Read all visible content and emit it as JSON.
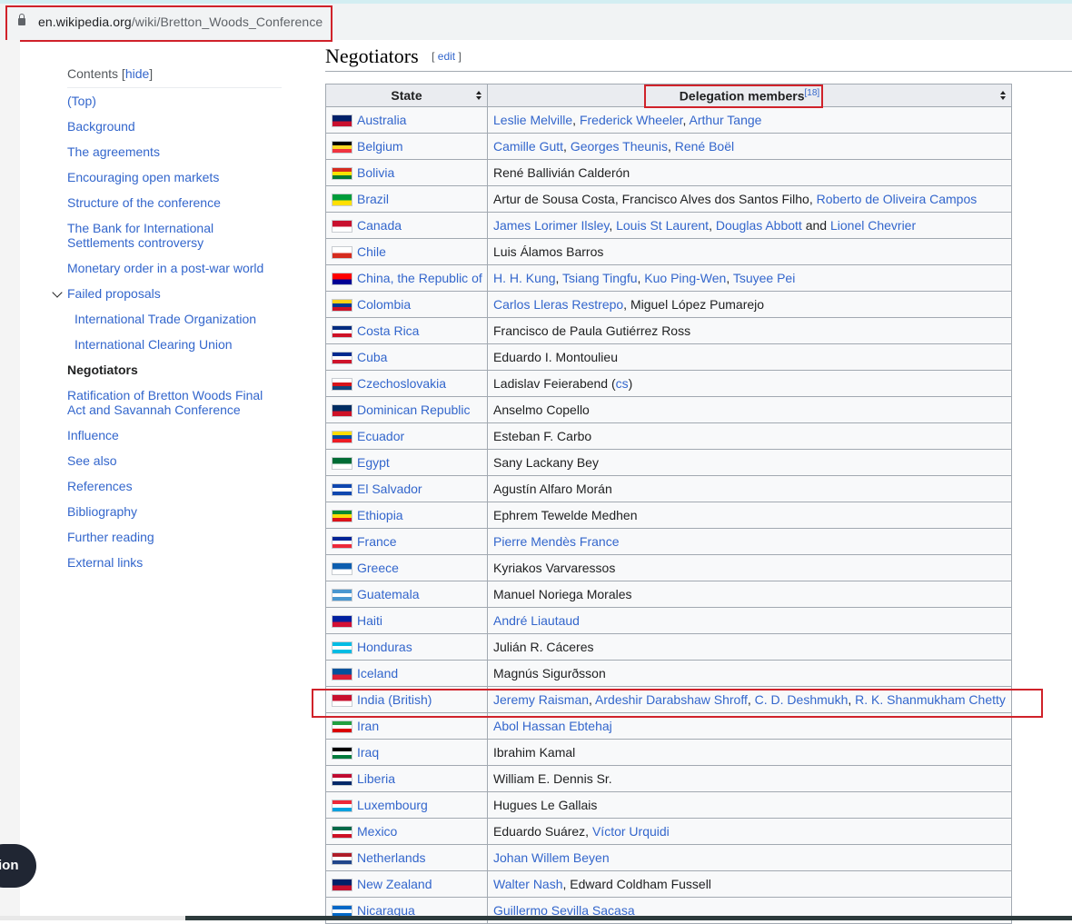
{
  "browser": {
    "url_host": "en.wikipedia.org",
    "url_path": "/wiki/Bretton_Woods_Conference"
  },
  "toc": {
    "title": "Contents",
    "hide_label": "hide",
    "items": [
      {
        "label": "(Top)"
      },
      {
        "label": "Background"
      },
      {
        "label": "The agreements"
      },
      {
        "label": "Encouraging open markets"
      },
      {
        "label": "Structure of the conference"
      },
      {
        "label": "The Bank for International Settlements controversy"
      },
      {
        "label": "Monetary order in a post-war world"
      },
      {
        "label": "Failed proposals"
      },
      {
        "label": "International Trade Organization"
      },
      {
        "label": "International Clearing Union"
      },
      {
        "label": "Negotiators"
      },
      {
        "label": "Ratification of Bretton Woods Final Act and Savannah Conference"
      },
      {
        "label": "Influence"
      },
      {
        "label": "See also"
      },
      {
        "label": "References"
      },
      {
        "label": "Bibliography"
      },
      {
        "label": "Further reading"
      },
      {
        "label": "External links"
      }
    ]
  },
  "section": {
    "title": "Negotiators",
    "edit_label": "edit"
  },
  "table": {
    "col_state": "State",
    "col_members": "Delegation members",
    "ref": "[18]",
    "rows": [
      {
        "state": "Australia",
        "flag": [
          "#012169",
          "#c8102e"
        ],
        "members": [
          {
            "t": "Leslie Melville",
            "l": true
          },
          {
            "t": ", ",
            "l": false
          },
          {
            "t": "Frederick Wheeler",
            "l": true
          },
          {
            "t": ", ",
            "l": false
          },
          {
            "t": "Arthur Tange",
            "l": true
          }
        ]
      },
      {
        "state": "Belgium",
        "flag": [
          "#000000",
          "#fdda24",
          "#ef3340"
        ],
        "members": [
          {
            "t": "Camille Gutt",
            "l": true
          },
          {
            "t": ", ",
            "l": false
          },
          {
            "t": "Georges Theunis",
            "l": true
          },
          {
            "t": ", ",
            "l": false
          },
          {
            "t": "René Boël",
            "l": true
          }
        ]
      },
      {
        "state": "Bolivia",
        "flag": [
          "#d52b1e",
          "#f9e300",
          "#007934"
        ],
        "members": [
          {
            "t": "René Ballivián Calderón",
            "l": false
          }
        ]
      },
      {
        "state": "Brazil",
        "flag": [
          "#009c3b",
          "#ffdf00"
        ],
        "members": [
          {
            "t": "Artur de Sousa Costa, Francisco Alves dos Santos Filho, ",
            "l": false
          },
          {
            "t": "Roberto de Oliveira Campos",
            "l": true
          }
        ]
      },
      {
        "state": "Canada",
        "flag": [
          "#c8102e",
          "#ffffff"
        ],
        "members": [
          {
            "t": "James Lorimer Ilsley",
            "l": true
          },
          {
            "t": ", ",
            "l": false
          },
          {
            "t": "Louis St Laurent",
            "l": true
          },
          {
            "t": ", ",
            "l": false
          },
          {
            "t": "Douglas Abbott",
            "l": true
          },
          {
            "t": " and ",
            "l": false
          },
          {
            "t": "Lionel Chevrier",
            "l": true
          }
        ]
      },
      {
        "state": "Chile",
        "flag": [
          "#ffffff",
          "#d52b1e"
        ],
        "members": [
          {
            "t": "Luis Álamos Barros",
            "l": false
          }
        ]
      },
      {
        "state": "China, the Republic of",
        "flag": [
          "#fe0000",
          "#000095"
        ],
        "members": [
          {
            "t": "H. H. Kung",
            "l": true
          },
          {
            "t": ", ",
            "l": false
          },
          {
            "t": "Tsiang Tingfu",
            "l": true
          },
          {
            "t": ", ",
            "l": false
          },
          {
            "t": "Kuo Ping-Wen",
            "l": true
          },
          {
            "t": ", ",
            "l": false
          },
          {
            "t": "Tsuyee Pei",
            "l": true
          }
        ]
      },
      {
        "state": "Colombia",
        "flag": [
          "#fcd116",
          "#003893",
          "#ce1126"
        ],
        "members": [
          {
            "t": "Carlos Lleras Restrepo",
            "l": true
          },
          {
            "t": ", Miguel López Pumarejo",
            "l": false
          }
        ]
      },
      {
        "state": "Costa Rica",
        "flag": [
          "#002b7f",
          "#ffffff",
          "#ce1126"
        ],
        "members": [
          {
            "t": "Francisco de Paula Gutiérrez Ross",
            "l": false
          }
        ]
      },
      {
        "state": "Cuba",
        "flag": [
          "#002a8f",
          "#ffffff",
          "#cf142b"
        ],
        "members": [
          {
            "t": "Eduardo I. Montoulieu",
            "l": false
          }
        ]
      },
      {
        "state": "Czechoslovakia",
        "flag": [
          "#ffffff",
          "#d7141a",
          "#11457e"
        ],
        "members": [
          {
            "t": "Ladislav Feierabend (",
            "l": false
          },
          {
            "t": "cs",
            "l": true
          },
          {
            "t": ")",
            "l": false
          }
        ]
      },
      {
        "state": "Dominican Republic",
        "flag": [
          "#002d62",
          "#ce1126"
        ],
        "members": [
          {
            "t": "Anselmo Copello",
            "l": false
          }
        ]
      },
      {
        "state": "Ecuador",
        "flag": [
          "#ffdd00",
          "#034ea2",
          "#ed1c24"
        ],
        "members": [
          {
            "t": "Esteban F. Carbo",
            "l": false
          }
        ]
      },
      {
        "state": "Egypt",
        "flag": [
          "#006c35",
          "#ffffff"
        ],
        "members": [
          {
            "t": "Sany Lackany Bey",
            "l": false
          }
        ]
      },
      {
        "state": "El Salvador",
        "flag": [
          "#0f47af",
          "#ffffff",
          "#0f47af"
        ],
        "members": [
          {
            "t": "Agustín Alfaro Morán",
            "l": false
          }
        ]
      },
      {
        "state": "Ethiopia",
        "flag": [
          "#078930",
          "#fcdd09",
          "#da121a"
        ],
        "members": [
          {
            "t": "Ephrem Tewelde Medhen",
            "l": false
          }
        ]
      },
      {
        "state": "France",
        "flag": [
          "#002395",
          "#ffffff",
          "#ed2939"
        ],
        "members": [
          {
            "t": "Pierre Mendès France",
            "l": true
          }
        ]
      },
      {
        "state": "Greece",
        "flag": [
          "#0d5eaf",
          "#ffffff"
        ],
        "members": [
          {
            "t": "Kyriakos Varvaressos",
            "l": false
          }
        ]
      },
      {
        "state": "Guatemala",
        "flag": [
          "#4997d0",
          "#ffffff",
          "#4997d0"
        ],
        "members": [
          {
            "t": "Manuel Noriega Morales",
            "l": false
          }
        ]
      },
      {
        "state": "Haiti",
        "flag": [
          "#00209f",
          "#d21034"
        ],
        "members": [
          {
            "t": "André Liautaud",
            "l": true
          }
        ]
      },
      {
        "state": "Honduras",
        "flag": [
          "#00bce4",
          "#ffffff",
          "#00bce4"
        ],
        "members": [
          {
            "t": "Julián R. Cáceres",
            "l": false
          }
        ]
      },
      {
        "state": "Iceland",
        "flag": [
          "#02529c",
          "#dc1e35"
        ],
        "members": [
          {
            "t": "Magnús Sigurðsson",
            "l": false
          }
        ]
      },
      {
        "state": "India (British)",
        "flag": [
          "#c8102e",
          "#ffffff"
        ],
        "members": [
          {
            "t": "Jeremy Raisman",
            "l": true
          },
          {
            "t": ", ",
            "l": false
          },
          {
            "t": "Ardeshir Darabshaw Shroff",
            "l": true
          },
          {
            "t": ", ",
            "l": false
          },
          {
            "t": "C. D. Deshmukh",
            "l": true
          },
          {
            "t": ", ",
            "l": false
          },
          {
            "t": "R. K. Shanmukham Chetty",
            "l": true
          }
        ]
      },
      {
        "state": "Iran",
        "flag": [
          "#239f40",
          "#ffffff",
          "#da0000"
        ],
        "members": [
          {
            "t": "Abol Hassan Ebtehaj",
            "l": true
          }
        ]
      },
      {
        "state": "Iraq",
        "flag": [
          "#000000",
          "#ffffff",
          "#007a3d"
        ],
        "members": [
          {
            "t": "Ibrahim Kamal",
            "l": false
          }
        ]
      },
      {
        "state": "Liberia",
        "flag": [
          "#bf0a30",
          "#ffffff",
          "#002868"
        ],
        "members": [
          {
            "t": "William E. Dennis Sr.",
            "l": false
          }
        ]
      },
      {
        "state": "Luxembourg",
        "flag": [
          "#ed2939",
          "#ffffff",
          "#00a1de"
        ],
        "members": [
          {
            "t": "Hugues Le Gallais",
            "l": false
          }
        ]
      },
      {
        "state": "Mexico",
        "flag": [
          "#006847",
          "#ffffff",
          "#ce1126"
        ],
        "members": [
          {
            "t": "Eduardo Suárez, ",
            "l": false
          },
          {
            "t": "Víctor Urquidi",
            "l": true
          }
        ]
      },
      {
        "state": "Netherlands",
        "flag": [
          "#ae1c28",
          "#ffffff",
          "#21468b"
        ],
        "members": [
          {
            "t": "Johan Willem Beyen",
            "l": true
          }
        ]
      },
      {
        "state": "New Zealand",
        "flag": [
          "#012169",
          "#c8102e"
        ],
        "members": [
          {
            "t": "Walter Nash",
            "l": true
          },
          {
            "t": ", Edward Coldham Fussell",
            "l": false
          }
        ]
      },
      {
        "state": "Nicaragua",
        "flag": [
          "#0067c6",
          "#ffffff",
          "#0067c6"
        ],
        "members": [
          {
            "t": "Guillermo Sevilla Sacasa",
            "l": true
          }
        ]
      }
    ]
  },
  "floating_pill": {
    "label": "ion"
  }
}
